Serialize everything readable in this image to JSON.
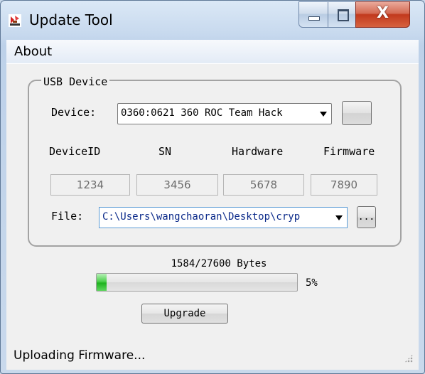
{
  "window": {
    "title": "Update Tool",
    "close_glyph": "X"
  },
  "menu": {
    "about": "About"
  },
  "usb_device": {
    "legend": "USB Device",
    "device_label": "Device:",
    "device_value": "0360:0621  360 ROC Team Hack",
    "columns": {
      "device_id": {
        "label": "DeviceID",
        "value": "1234"
      },
      "sn": {
        "label": "SN",
        "value": "3456"
      },
      "hardware": {
        "label": "Hardware",
        "value": "5678"
      },
      "firmware": {
        "label": "Firmware",
        "value": "7890"
      }
    },
    "file_label": "File:",
    "file_value": "C:\\Users\\wangchaoran\\Desktop\\cryp",
    "browse_label": "..."
  },
  "progress": {
    "bytes_text": "1584/27600 Bytes",
    "percent_text": "5%",
    "fraction": 0.05
  },
  "upgrade_label": "Upgrade",
  "status": "Uploading Firmware...",
  "colors": {
    "progress_green": "#1fb31f",
    "close_red": "#c2391d"
  },
  "icons": {
    "app": "update-tool-app-icon",
    "minimize": "minimize-icon",
    "maximize": "maximize-icon",
    "close": "close-icon",
    "dropdown": "chevron-down-icon",
    "grip": "resize-grip-icon"
  }
}
